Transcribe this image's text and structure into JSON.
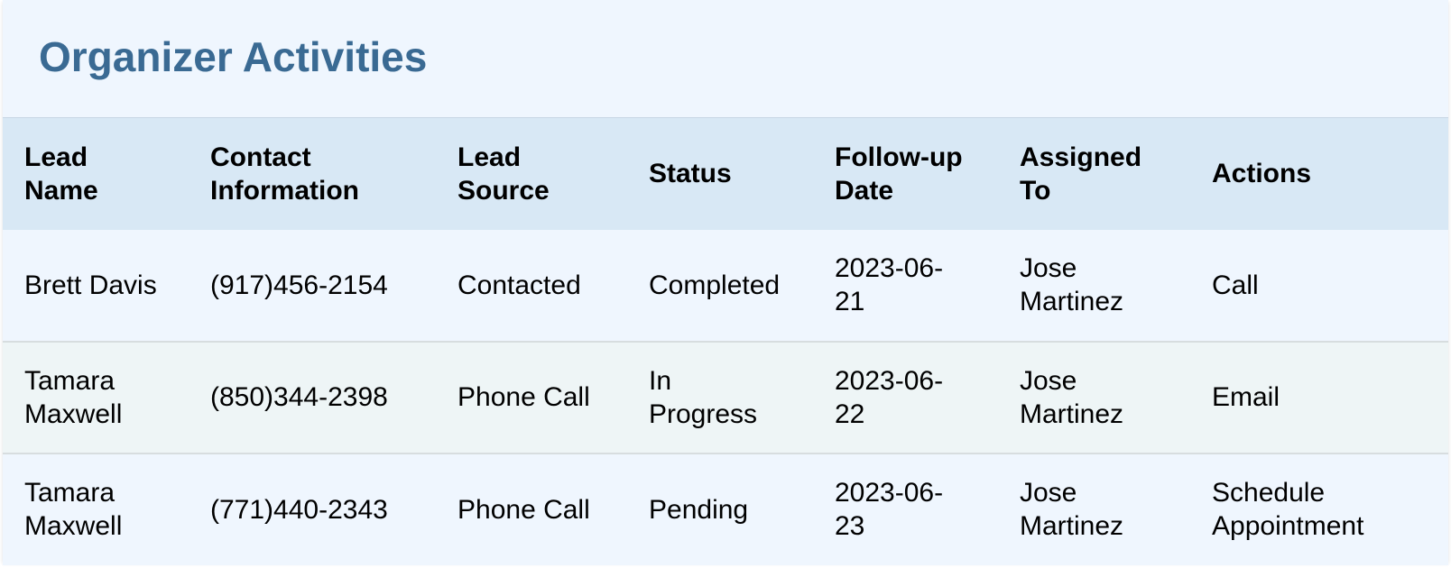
{
  "page": {
    "title": "Organizer Activities"
  },
  "table": {
    "headers": [
      [
        "Lead",
        "Name"
      ],
      [
        "Contact",
        "Information"
      ],
      [
        "Lead",
        "Source"
      ],
      [
        "Status"
      ],
      [
        "Follow-up",
        "Date"
      ],
      [
        "Assigned",
        "To"
      ],
      [
        "Actions"
      ]
    ],
    "rows": [
      {
        "lead_name": [
          "Brett Davis"
        ],
        "contact": "(917)456-2154",
        "source": "Contacted",
        "status": [
          "Completed"
        ],
        "follow_up": [
          "2023-06-",
          "21"
        ],
        "assigned": [
          "Jose",
          "Martinez"
        ],
        "action": [
          "Call"
        ]
      },
      {
        "lead_name": [
          "Tamara",
          "Maxwell"
        ],
        "contact": "(850)344-2398",
        "source": "Phone Call",
        "status": [
          "In",
          "Progress"
        ],
        "follow_up": [
          "2023-06-",
          "22"
        ],
        "assigned": [
          "Jose",
          "Martinez"
        ],
        "action": [
          "Email"
        ]
      },
      {
        "lead_name": [
          "Tamara",
          "Maxwell"
        ],
        "contact": "(771)440-2343",
        "source": "Phone Call",
        "status": [
          "Pending"
        ],
        "follow_up": [
          "2023-06-",
          "23"
        ],
        "assigned": [
          "Jose",
          "Martinez"
        ],
        "action": [
          "Schedule",
          "Appointment"
        ]
      }
    ]
  },
  "colors": {
    "title": "#3a6a93",
    "panel_background": "#eff6fe",
    "header_background": "#d8e8f5",
    "alt_row_background": "#eef5f6"
  }
}
